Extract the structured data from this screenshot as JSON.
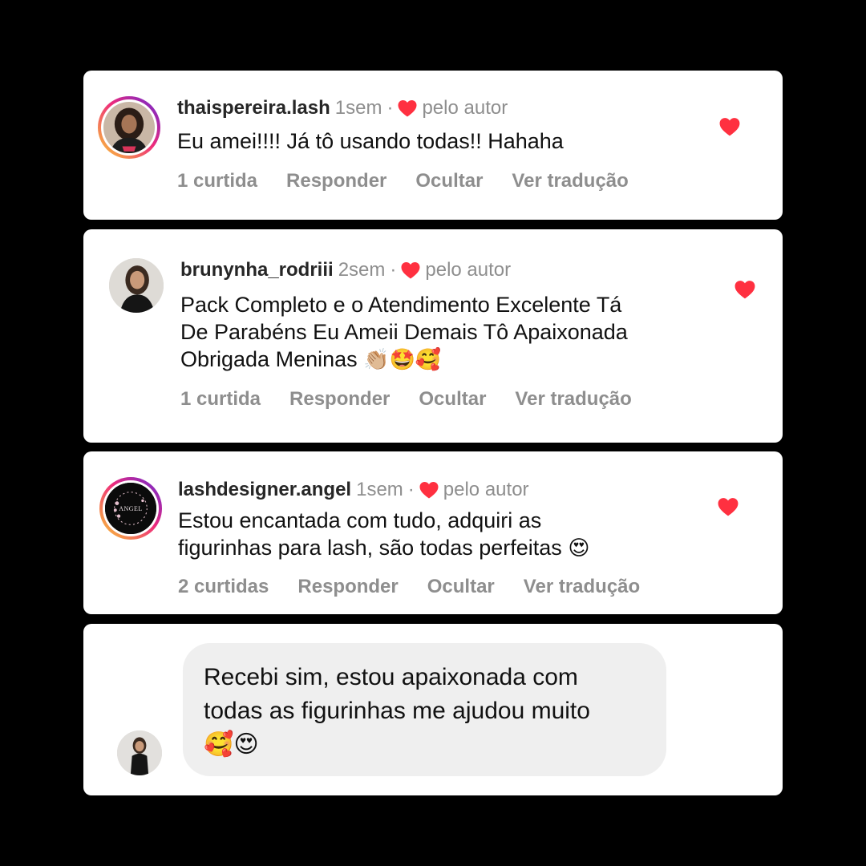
{
  "comments": [
    {
      "username": "thaispereira.lash",
      "time": "1sem",
      "separator": "·",
      "liked_by": "pelo autor",
      "text": "Eu amei!!!! Já tô usando todas!! Hahaha",
      "likes": "1 curtida",
      "reply": "Responder",
      "hide": "Ocultar",
      "translate": "Ver tradução"
    },
    {
      "username": "brunynha_rodriii",
      "time": "2sem",
      "separator": "·",
      "liked_by": "pelo autor",
      "text_lines": [
        "Pack Completo e o Atendimento Excelente Tá",
        "De Parabéns Eu Ameii Demais Tô Apaixonada",
        "Obrigada Meninas"
      ],
      "emojis": "👏🏼🤩🥰",
      "likes": "1 curtida",
      "reply": "Responder",
      "hide": "Ocultar",
      "translate": "Ver tradução"
    },
    {
      "username": "lashdesigner.angel",
      "time": "1sem",
      "separator": "·",
      "liked_by": "pelo autor",
      "avatar_text": "ANGEL",
      "text_lines": [
        "Estou encantada com tudo, adquiri as",
        "figurinhas para lash, são todas perfeitas"
      ],
      "emojis": "😍",
      "likes": "2 curtidas",
      "reply": "Responder",
      "hide": "Ocultar",
      "translate": "Ver tradução"
    }
  ],
  "message": {
    "lines": [
      "Recebi sim, estou apaixonada com",
      "todas as figurinhas me ajudou muito"
    ],
    "emojis": "🥰😍"
  },
  "colors": {
    "heart": "#ff3040",
    "muted": "#8e8e8e",
    "bubble": "#efefef"
  }
}
